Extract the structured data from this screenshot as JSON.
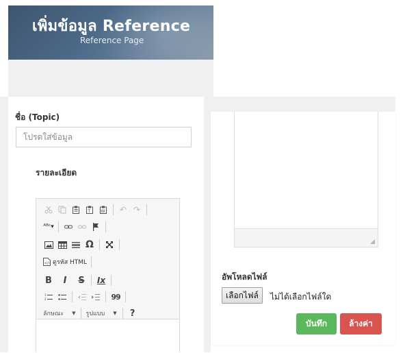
{
  "header": {
    "title": "เพิ่มข้อมูล Reference",
    "subtitle": "Reference Page"
  },
  "form": {
    "topic_label": "ชื่อ (Topic)",
    "topic_placeholder": "โปรดใส่ข้อมูล",
    "topic_value": "",
    "detail_label": "รายละเอียด"
  },
  "editor": {
    "toolbar_rows": [
      [
        "cut-icon",
        "copy-icon",
        "paste-icon",
        "paste-text-icon",
        "paste-word-icon",
        "undo-icon",
        "redo-icon"
      ],
      [
        "spellcheck-icon",
        "link-icon",
        "unlink-icon",
        "anchor-icon"
      ],
      [
        "image-icon",
        "table-icon",
        "horizontal-rule-icon",
        "special-char-icon",
        "maximize-icon"
      ],
      [
        "source-icon"
      ],
      [
        "bold-icon",
        "italic-icon",
        "strike-icon",
        "remove-format-icon"
      ],
      [
        "numbered-list-icon",
        "bulleted-list-icon",
        "outdent-icon",
        "indent-icon",
        "blockquote-icon"
      ],
      [
        "styles-combo",
        "format-combo",
        "help-icon"
      ]
    ],
    "source_label": "ดูรหัส HTML",
    "styles_label": "ลักษณะ",
    "format_label": "รูปแบบ",
    "bold_glyph": "B",
    "italic_glyph": "I",
    "strike_glyph": "S",
    "remove_format_glyph": "Ix",
    "special_char_glyph": "Ω",
    "blockquote_glyph": "99",
    "help_glyph": "?"
  },
  "upload": {
    "label": "อัพโหลดไฟล์",
    "choose_button": "เลือกไฟล์",
    "status": "ไม่ได้เลือกไฟล์ใด"
  },
  "actions": {
    "save": "บันทึก",
    "reset": "ล้างค่า"
  },
  "colors": {
    "banner": "#4a6480",
    "save": "#5cb85c",
    "reset": "#d9534f"
  }
}
